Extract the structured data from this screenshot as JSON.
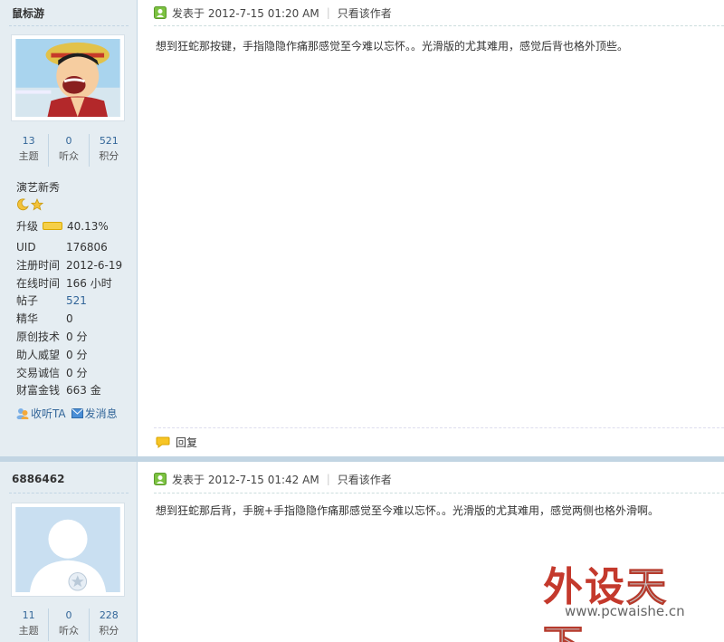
{
  "posts": [
    {
      "author": "鼠标游",
      "stats": [
        {
          "num": "13",
          "label": "主题"
        },
        {
          "num": "0",
          "label": "听众"
        },
        {
          "num": "521",
          "label": "积分"
        }
      ],
      "group": "演艺新秀",
      "level_label": "升级",
      "level_percent": "40.13%",
      "profile": [
        {
          "k": "UID",
          "v": "176806"
        },
        {
          "k": "注册时间",
          "v": "2012-6-19"
        },
        {
          "k": "在线时间",
          "v": "166 小时"
        },
        {
          "k": "帖子",
          "v": "521"
        },
        {
          "k": "精华",
          "v": "0"
        },
        {
          "k": "原创技术",
          "v": "0 分"
        },
        {
          "k": "助人威望",
          "v": "0 分"
        },
        {
          "k": "交易诚信",
          "v": "0 分"
        },
        {
          "k": "财富金钱",
          "v": "663 金"
        }
      ],
      "follow_label": "收听TA",
      "message_label": "发消息",
      "posted_at": "发表于 2012-7-15 01:20 AM",
      "only_author": "只看该作者",
      "content": "想到狂蛇那按键，手指隐隐作痛那感觉至今难以忘怀。。光滑版的尤其难用，感觉后背也格外顶些。",
      "reply_label": "回复"
    },
    {
      "author": "6886462",
      "stats": [
        {
          "num": "11",
          "label": "主题"
        },
        {
          "num": "0",
          "label": "听众"
        },
        {
          "num": "228",
          "label": "积分"
        }
      ],
      "posted_at": "发表于 2012-7-15 01:42 AM",
      "only_author": "只看该作者",
      "content": "想到狂蛇那后背，手腕+手指隐隐作痛那感觉至今难以忘怀。。光滑版的尤其难用，感觉两侧也格外滑啊。"
    }
  ],
  "watermark": {
    "main_left": "外设",
    "main_right": "天下",
    "url": "www.pcwaishe.cn"
  },
  "icons": {
    "online": "online-status-icon",
    "follow": "follow-icon",
    "message": "envelope-icon",
    "reply": "reply-bubble-icon",
    "moon": "moon-medal-icon",
    "star": "star-medal-icon"
  },
  "colors": {
    "sidebar_bg": "#e5edf2",
    "link": "#336699",
    "separator": "#c2d5e3"
  }
}
